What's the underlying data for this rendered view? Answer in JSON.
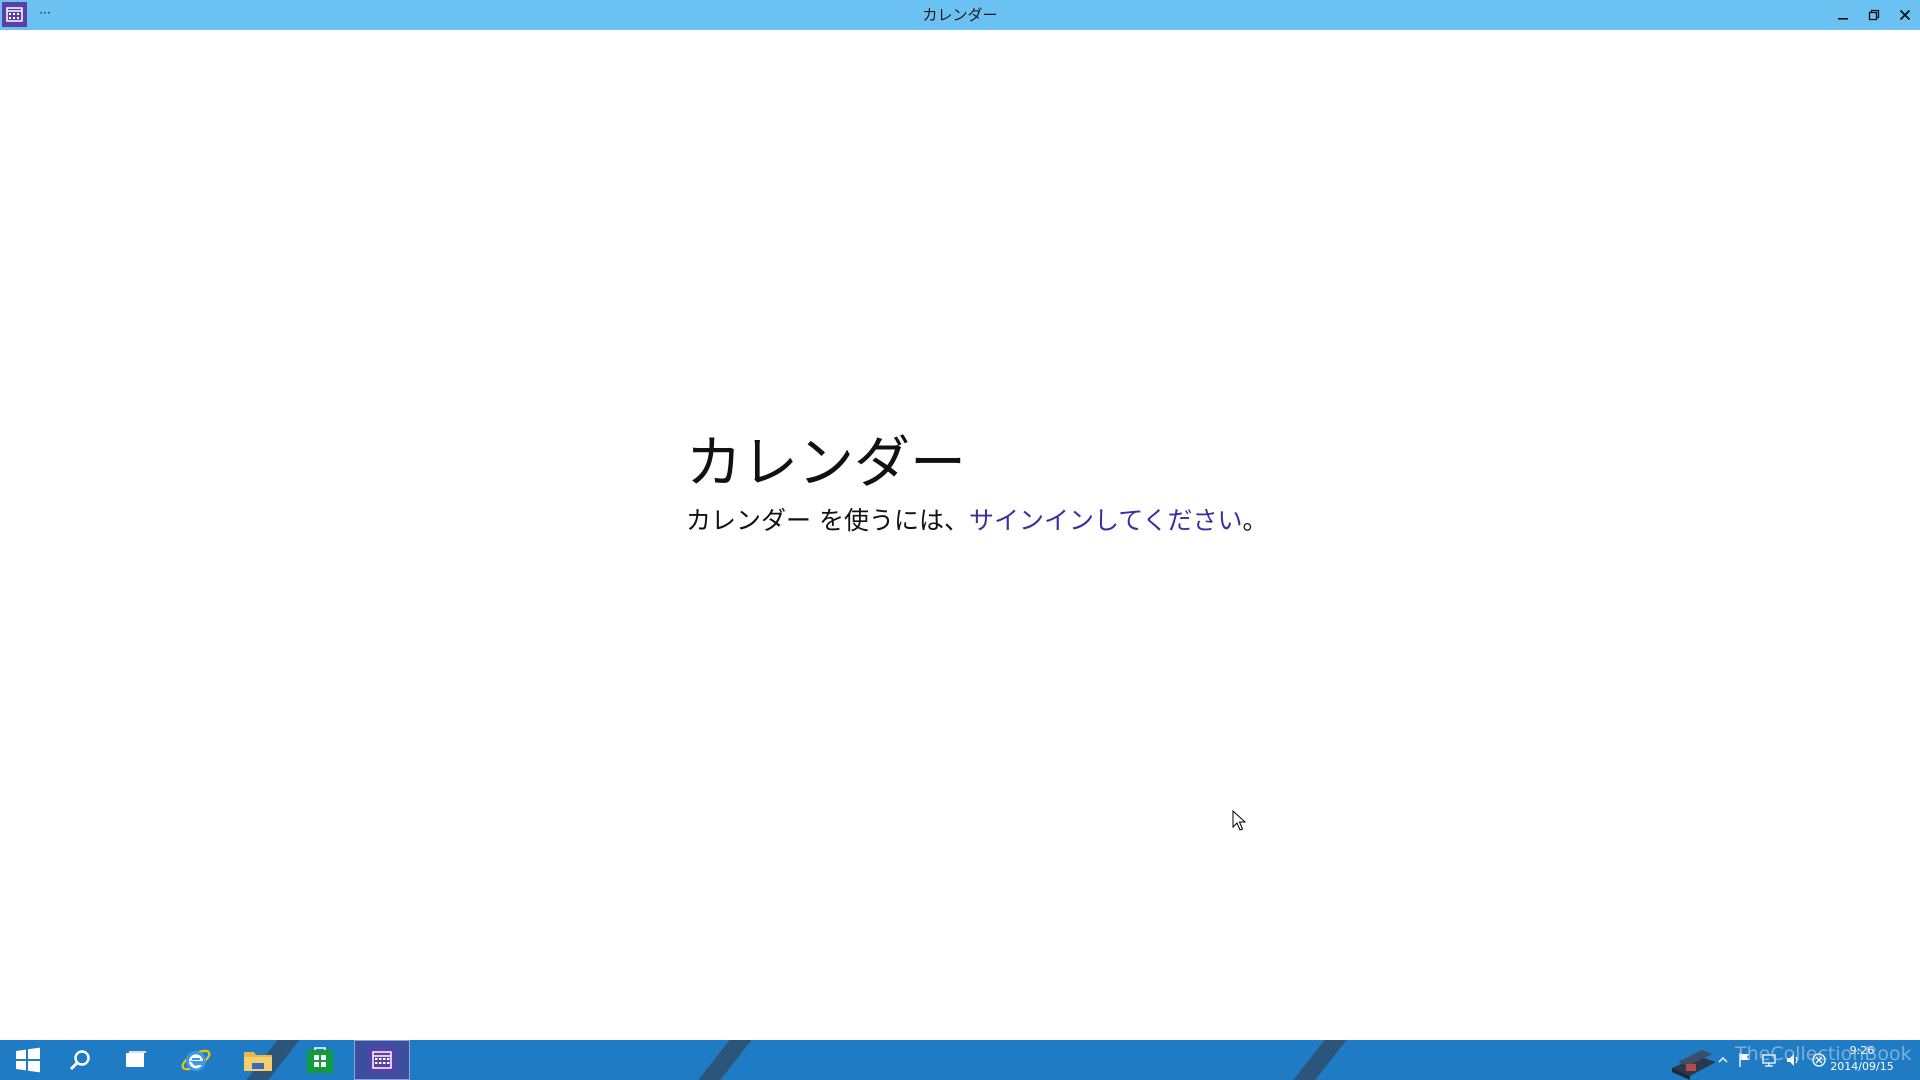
{
  "window": {
    "title": "カレンダー",
    "menu_glyph": "···",
    "titlebar_color": "#6bc1f1"
  },
  "main": {
    "heading": "カレンダー",
    "signin_prefix": "カレンダー を使うには、",
    "signin_link": "サインインしてください",
    "signin_suffix": "。",
    "link_color": "#3d2fa2"
  },
  "taskbar": {
    "color": "#1f7cc4",
    "pinned": [
      {
        "name": "start-windows-icon"
      },
      {
        "name": "search-icon"
      },
      {
        "name": "task-view-icon"
      },
      {
        "name": "internet-explorer-icon"
      },
      {
        "name": "file-explorer-icon"
      },
      {
        "name": "store-icon"
      },
      {
        "name": "calendar-app-icon",
        "active": true
      }
    ],
    "tray": {
      "watermark": "TheCollectionBook",
      "time": "9:26",
      "date": "2014/09/15"
    }
  }
}
